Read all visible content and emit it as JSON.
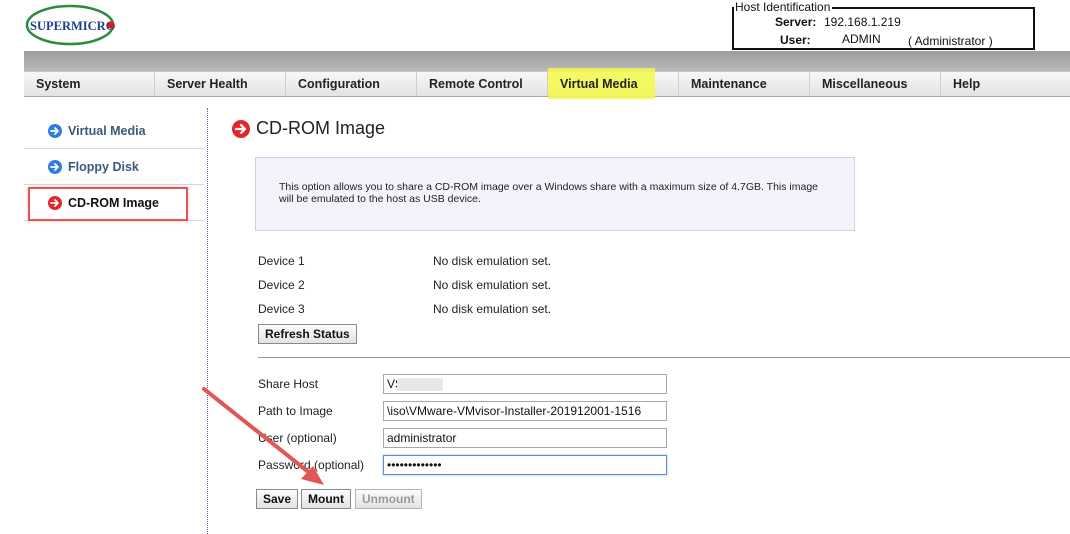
{
  "header": {
    "logo_text": "SUPERMICRO",
    "host_identification": {
      "legend": "Host Identification",
      "server_label": "Server:",
      "server_value": "192.168.1.219",
      "user_label": "User:",
      "user_value": "ADMIN",
      "user_role": "( Administrator )"
    }
  },
  "nav": {
    "tabs": [
      {
        "label": "System"
      },
      {
        "label": "Server Health"
      },
      {
        "label": "Configuration"
      },
      {
        "label": "Remote Control"
      },
      {
        "label": "Virtual Media"
      },
      {
        "label": "Maintenance"
      },
      {
        "label": "Miscellaneous"
      },
      {
        "label": "Help"
      }
    ],
    "active": "Virtual Media"
  },
  "sidebar": {
    "items": [
      {
        "label": "Virtual Media"
      },
      {
        "label": "Floppy Disk"
      },
      {
        "label": "CD-ROM Image"
      }
    ]
  },
  "main": {
    "title": "CD-ROM Image",
    "info_text": "This option allows you to share a CD-ROM image over a Windows share with a maximum size of 4.7GB. This image will be emulated to the host as USB device.",
    "devices": [
      {
        "label": "Device 1",
        "status": "No disk emulation set."
      },
      {
        "label": "Device 2",
        "status": "No disk emulation set."
      },
      {
        "label": "Device 3",
        "status": "No disk emulation set."
      }
    ],
    "refresh_label": "Refresh Status",
    "form": {
      "share_host_label": "Share Host",
      "share_host_value": "VS",
      "path_label": "Path to Image",
      "path_value": "\\iso\\VMware-VMvisor-Installer-201912001-1516",
      "user_label": "User (optional)",
      "user_value": "administrator",
      "password_label": "Password (optional)",
      "password_value": "•••••••••••••"
    },
    "buttons": {
      "save": "Save",
      "mount": "Mount",
      "unmount": "Unmount"
    }
  },
  "colors": {
    "tab_highlight": "#f4fa4a",
    "annotation_red": "#e35656",
    "icon_blue": "#2c7fd8",
    "icon_red": "#e2262a"
  },
  "icons": {
    "nav_arrow": "circle-arrow-right-icon"
  }
}
